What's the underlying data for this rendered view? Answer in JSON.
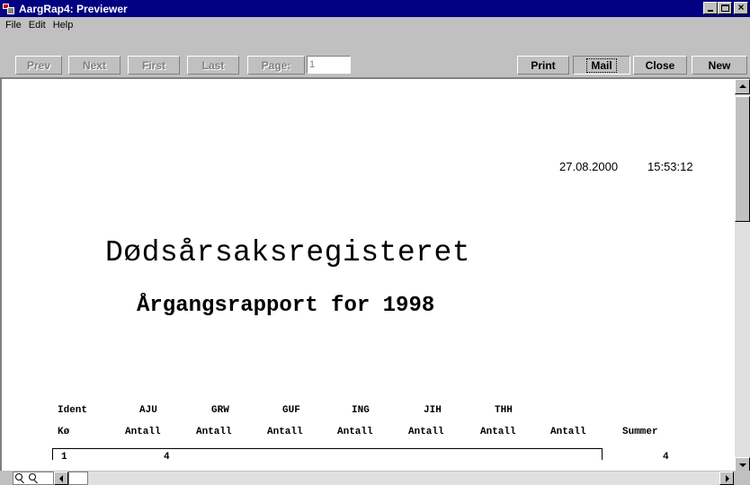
{
  "window": {
    "title": "AargRap4: Previewer"
  },
  "menu": {
    "items": [
      "File",
      "Edit",
      "Help"
    ]
  },
  "toolbar": {
    "prev": "Prev",
    "next": "Next",
    "first": "First",
    "last": "Last",
    "page_label": "Page:",
    "page_value": "1",
    "print": "Print",
    "mail": "Mail",
    "close": "Close",
    "new": "New"
  },
  "report": {
    "date": "27.08.2000",
    "time": "15:53:12",
    "heading": "Dødsårsaksregisteret",
    "subheading": "Årgangsrapport for 1998",
    "header_row1": [
      "Ident",
      "AJU",
      "GRW",
      "GUF",
      "ING",
      "JIH",
      "THH"
    ],
    "header_row2": [
      "Kø",
      "Antall",
      "Antall",
      "Antall",
      "Antall",
      "Antall",
      "Antall",
      "Antall",
      "Summer"
    ],
    "rows": [
      {
        "ident": "1",
        "aju": "4",
        "sum": "4"
      }
    ]
  },
  "colors": {
    "title_bar": "#000080",
    "chrome": "#c0c0c0",
    "paper": "#ffffff"
  },
  "icons": [
    "app-icon",
    "minimize-icon",
    "maximize-icon",
    "close-icon",
    "scroll-up-icon",
    "scroll-down-icon",
    "scroll-left-icon",
    "scroll-right-icon",
    "zoom-icon",
    "zoom-fit-icon"
  ]
}
